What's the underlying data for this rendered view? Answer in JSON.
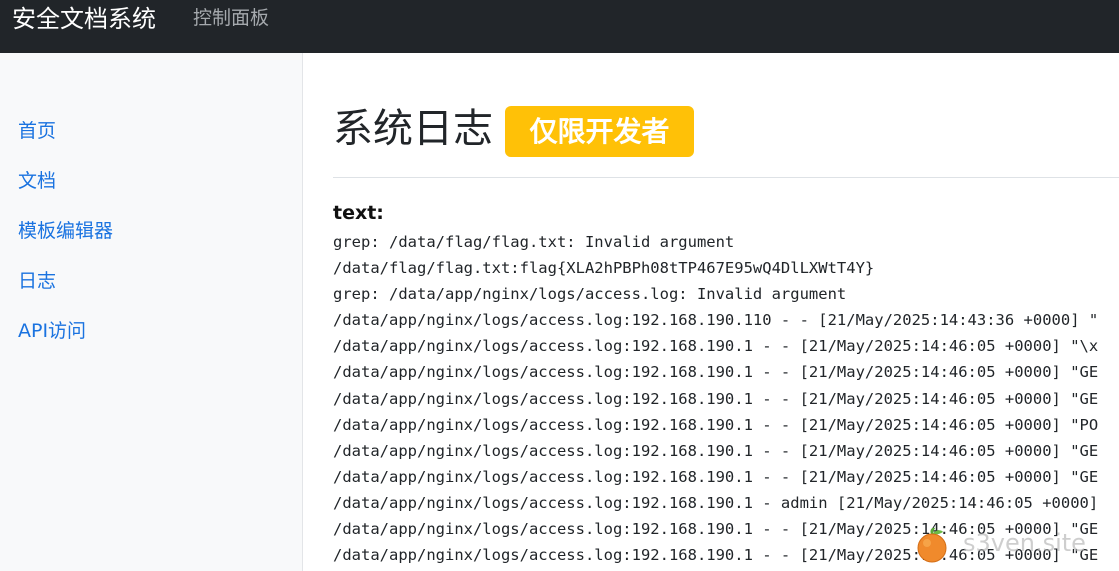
{
  "navbar": {
    "brand": "安全文档系统",
    "link": "控制面板"
  },
  "sidebar": {
    "items": [
      {
        "label": "首页"
      },
      {
        "label": "文档"
      },
      {
        "label": "模板编辑器"
      },
      {
        "label": "日志"
      },
      {
        "label": "API访问"
      }
    ]
  },
  "main": {
    "title": "系统日志",
    "badge": "仅限开发者",
    "text_label": "text:",
    "log_lines": [
      "grep: /data/flag/flag.txt: Invalid argument",
      "/data/flag/flag.txt:flag{XLA2hPBPh08tTP467E95wQ4DlLXWtT4Y}",
      "grep: /data/app/nginx/logs/access.log: Invalid argument",
      "/data/app/nginx/logs/access.log:192.168.190.110 - - [21/May/2025:14:43:36 +0000] \"",
      "/data/app/nginx/logs/access.log:192.168.190.1 - - [21/May/2025:14:46:05 +0000] \"\\x",
      "/data/app/nginx/logs/access.log:192.168.190.1 - - [21/May/2025:14:46:05 +0000] \"GE",
      "/data/app/nginx/logs/access.log:192.168.190.1 - - [21/May/2025:14:46:05 +0000] \"GE",
      "/data/app/nginx/logs/access.log:192.168.190.1 - - [21/May/2025:14:46:05 +0000] \"PO",
      "/data/app/nginx/logs/access.log:192.168.190.1 - - [21/May/2025:14:46:05 +0000] \"GE",
      "/data/app/nginx/logs/access.log:192.168.190.1 - - [21/May/2025:14:46:05 +0000] \"GE",
      "/data/app/nginx/logs/access.log:192.168.190.1 - admin [21/May/2025:14:46:05 +0000]",
      "/data/app/nginx/logs/access.log:192.168.190.1 - - [21/May/2025:14:46:05 +0000] \"GE",
      "/data/app/nginx/logs/access.log:192.168.190.1 - - [21/May/2025:14:46:05 +0000] \"GE"
    ]
  },
  "watermark": {
    "text": "s3ven.site",
    "icon": "tangerine-icon"
  },
  "colors": {
    "navbar_bg": "#212529",
    "link": "#1a73e0",
    "badge_bg": "#ffc107",
    "sidebar_bg": "#f8f9fa"
  }
}
